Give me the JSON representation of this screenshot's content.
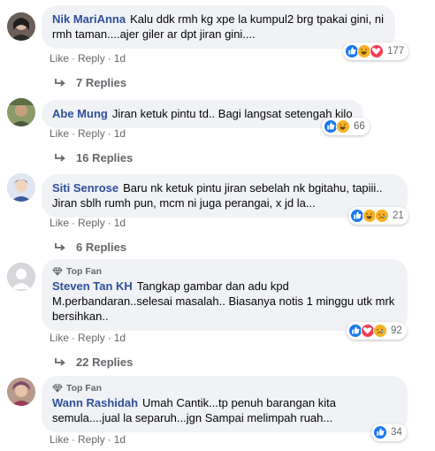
{
  "actions": {
    "like": "Like",
    "reply": "Reply",
    "dot": "·"
  },
  "badge": {
    "top_fan": "Top Fan"
  },
  "colors": {
    "author": "#2d4f9a",
    "bubble": "#f0f2f5",
    "meta": "#65676b"
  },
  "comments": [
    {
      "author": "Nik MariAnna",
      "text": "Kalu ddk rmh kg xpe la kumpul2 brg tpakai gini, ni rmh taman....ajer giler ar dpt jiran gini....",
      "time": "1d",
      "reactions": [
        "like",
        "haha",
        "love"
      ],
      "reaction_count": "177",
      "replies_label": "7 Replies",
      "top_fan": false
    },
    {
      "author": "Abe Mung",
      "text": "Jiran ketuk pintu td.. Bagi langsat setengah kilo",
      "time": "1d",
      "reactions": [
        "like",
        "haha"
      ],
      "reaction_count": "66",
      "replies_label": "16 Replies",
      "top_fan": false
    },
    {
      "author": "Siti Senrose",
      "text": "Baru nk ketuk pintu jiran sebelah nk bgitahu, tapiii.. Jiran sblh rumh pun, mcm ni juga perangai, x jd la...",
      "time": "1d",
      "reactions": [
        "like",
        "haha",
        "sad"
      ],
      "reaction_count": "21",
      "replies_label": "6 Replies",
      "top_fan": false
    },
    {
      "author": "Steven Tan KH",
      "text": "Tangkap gambar dan adu kpd M.perbandaran..selesai masalah.. Biasanya notis 1 minggu utk mrk bersihkan..",
      "time": "1d",
      "reactions": [
        "like",
        "love",
        "sad"
      ],
      "reaction_count": "92",
      "replies_label": "22 Replies",
      "top_fan": true
    },
    {
      "author": "Wann Rashidah",
      "text": "Umah Cantik...tp penuh barangan kita semula....jual la separuh...jgn Sampai melimpah ruah...",
      "time": "1d",
      "reactions": [
        "like"
      ],
      "reaction_count": "34",
      "replies_label": "",
      "top_fan": true
    }
  ]
}
